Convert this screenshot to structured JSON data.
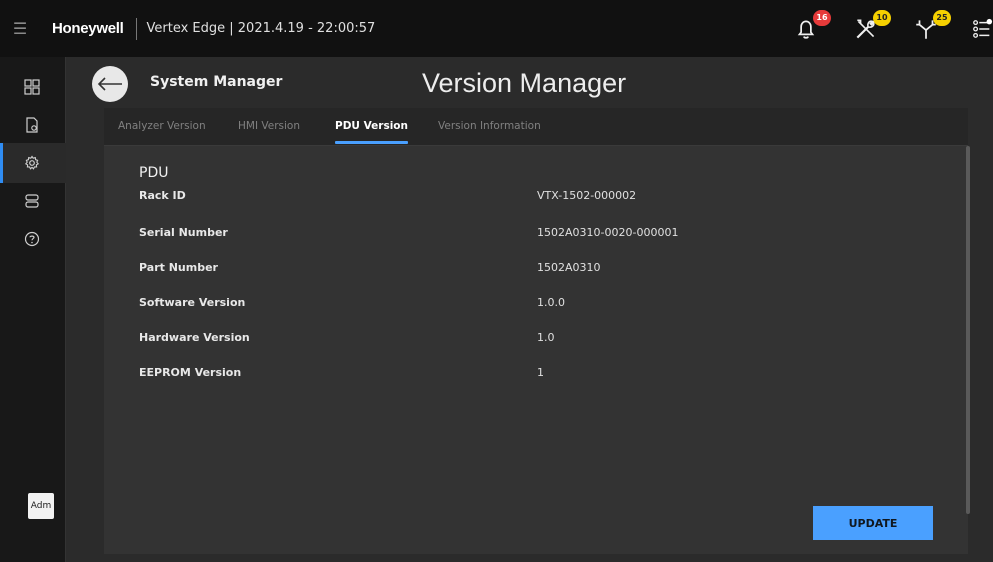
{
  "topbar": {
    "brand": "Honeywell",
    "title": "Vertex Edge | 2021.4.19 - 22:00:57",
    "alerts": [
      {
        "icon": "bell-icon",
        "count": "16",
        "color": "#e63a3a"
      },
      {
        "icon": "tools-icon",
        "count": "10",
        "color": "#f5d000"
      },
      {
        "icon": "network-icon",
        "count": "25",
        "color": "#f5d000"
      }
    ]
  },
  "sidenav": {
    "items": [
      "dashboard-icon",
      "document-icon",
      "settings-icon",
      "hardware-icon",
      "help-icon"
    ],
    "active": "settings-icon",
    "user_label": "Adm"
  },
  "header": {
    "section": "System Manager",
    "page_title": "Version Manager"
  },
  "tabs": [
    {
      "label": "Analyzer Version",
      "active": false
    },
    {
      "label": "HMI Version",
      "active": false
    },
    {
      "label": "PDU Version",
      "active": true
    },
    {
      "label": "Version Information",
      "active": false
    }
  ],
  "pdu": {
    "heading": "PDU",
    "rows": [
      {
        "label": "Rack ID",
        "value": "VTX-1502-000002"
      },
      {
        "label": "Serial Number",
        "value": "1502A0310-0020-000001"
      },
      {
        "label": "Part Number",
        "value": "1502A0310"
      },
      {
        "label": "Software Version",
        "value": "1.0.0"
      },
      {
        "label": "Hardware Version",
        "value": "1.0"
      },
      {
        "label": "EEPROM Version",
        "value": "1"
      }
    ]
  },
  "actions": {
    "update_label": "UPDATE"
  },
  "colors": {
    "accent": "#4aa0ff",
    "badge_red": "#e63a3a",
    "badge_yellow": "#f5d000"
  }
}
